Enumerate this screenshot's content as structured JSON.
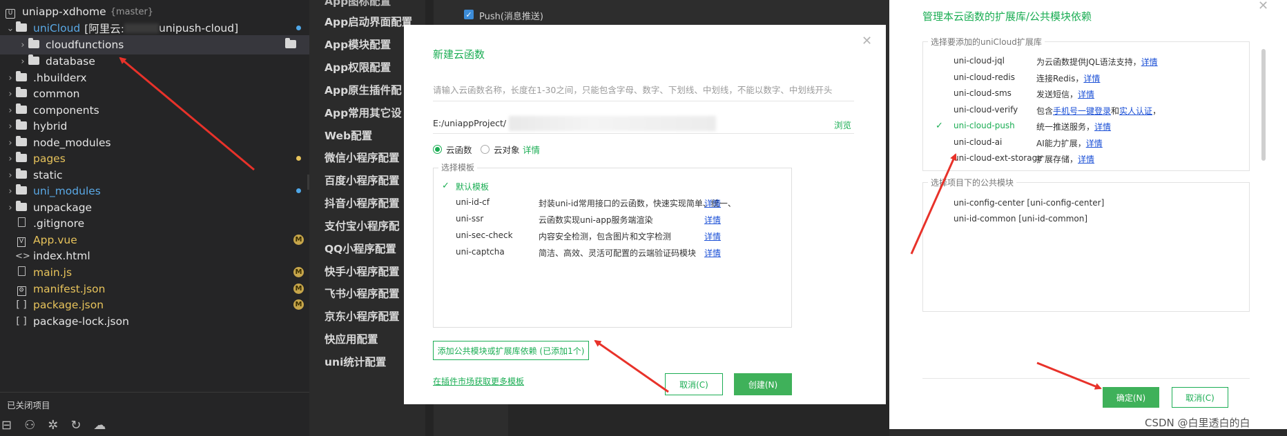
{
  "explorer": {
    "project": "uniapp-xdhome",
    "branch": "{master}",
    "rows": [
      {
        "label": "uniCloud",
        "suffix": "[阿里云:",
        "suffix2": "unipush-cloud]"
      },
      {
        "label": "cloudfunctions"
      },
      {
        "label": "database"
      },
      {
        "label": ".hbuilderx"
      },
      {
        "label": "common"
      },
      {
        "label": "components"
      },
      {
        "label": "hybrid"
      },
      {
        "label": "node_modules"
      },
      {
        "label": "pages"
      },
      {
        "label": "static"
      },
      {
        "label": "uni_modules"
      },
      {
        "label": "unpackage"
      },
      {
        "label": ".gitignore"
      },
      {
        "label": "App.vue"
      },
      {
        "label": "index.html"
      },
      {
        "label": "main.js"
      },
      {
        "label": "manifest.json"
      },
      {
        "label": "package.json"
      },
      {
        "label": "package-lock.json"
      }
    ],
    "modified_badge": "M",
    "closed_projects": "已关闭项目",
    "colors": {
      "folder_blue": "#5aa9e6",
      "modified_yellow": "#e7c35b"
    }
  },
  "config_nav": {
    "items": [
      "App启动界面配置",
      "App模块配置",
      "App权限配置",
      "App原生插件配",
      "App常用其它设",
      "Web配置",
      "微信小程序配置",
      "百度小程序配置",
      "抖音小程序配置",
      "支付宝小程序配",
      "QQ小程序配置",
      "快手小程序配置",
      "飞书小程序配置",
      "京东小程序配置",
      "快应用配置",
      "uni统计配置"
    ],
    "top_partial": "App图标配置"
  },
  "content": {
    "push_label": "Push(消息推送)"
  },
  "new_fn_dialog": {
    "title": "新建云函数",
    "name_placeholder": "请输入云函数名称，长度在1-30之间，只能包含字母、数字、下划线、中划线，不能以数字、中划线开头",
    "path": "E:/uniappProject/",
    "browse": "浏览",
    "type_function": "云函数",
    "type_object": "云对象",
    "detail": "详情",
    "template_legend": "选择模板",
    "templates": [
      {
        "name": "默认模板",
        "desc": "",
        "link": "",
        "checked": true
      },
      {
        "name": "uni-id-cf",
        "desc": "封装uni-id常用接口的云函数，快速实现简单、统一、",
        "link": "详情",
        "checked": false
      },
      {
        "name": "uni-ssr",
        "desc": "云函数实现uni-app服务端渲染",
        "link": "详情",
        "checked": false
      },
      {
        "name": "uni-sec-check",
        "desc": "内容安全检测，包含图片和文字检测",
        "link": "详情",
        "checked": false
      },
      {
        "name": "uni-captcha",
        "desc": "简洁、高效、灵活可配置的云端验证码模块",
        "link": "详情",
        "checked": false
      }
    ],
    "add_dep_button": "添加公共模块或扩展库依赖 (已添加1个)",
    "market_link": "在插件市场获取更多模板",
    "cancel": "取消(C)",
    "create": "创建(N)"
  },
  "ext_dialog": {
    "title": "管理本云函数的扩展库/公共模块依赖",
    "libs_legend": "选择要添加的uniCloud扩展库",
    "libs": [
      {
        "name": "uni-cloud-jql",
        "desc": "为云函数提供JQL语法支持，",
        "link": "详情",
        "checked": false
      },
      {
        "name": "uni-cloud-redis",
        "desc": "连接Redis，",
        "link": "详情",
        "checked": false
      },
      {
        "name": "uni-cloud-sms",
        "desc": "发送短信，",
        "link": "详情",
        "checked": false
      },
      {
        "name": "uni-cloud-verify",
        "desc": "包含",
        "link": "手机号一键登录",
        "desc2": "和",
        "link2": "实人认证",
        "desc3": "，",
        "checked": false
      },
      {
        "name": "uni-cloud-push",
        "desc": "统一推送服务，",
        "link": "详情",
        "checked": true
      },
      {
        "name": "uni-cloud-ai",
        "desc": "AI能力扩展，",
        "link": "详情",
        "checked": false
      },
      {
        "name": "uni-cloud-ext-storage",
        "desc": "扩展存储，",
        "link": "详情",
        "checked": false
      }
    ],
    "public_legend": "选择项目下的公共模块",
    "public_modules": [
      "uni-config-center [uni-config-center]",
      "uni-id-common [uni-id-common]"
    ],
    "ok": "确定(N)",
    "cancel": "取消(C)"
  },
  "watermark": "CSDN @白里透白的白",
  "colors": {
    "accent_green": "#1aad53",
    "arrow_red": "#e8322a",
    "link_blue": "#1a4fd6"
  }
}
